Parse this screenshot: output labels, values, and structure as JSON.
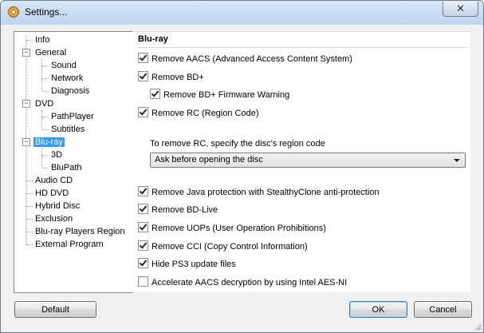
{
  "window": {
    "title": "Settings...",
    "close_glyph": "✕"
  },
  "tree": {
    "items": [
      {
        "label": "Info"
      },
      {
        "label": "General"
      },
      {
        "label": "Sound"
      },
      {
        "label": "Network"
      },
      {
        "label": "Diagnosis"
      },
      {
        "label": "DVD"
      },
      {
        "label": "PathPlayer"
      },
      {
        "label": "Subtitles"
      },
      {
        "label": "Blu-ray"
      },
      {
        "label": "3D"
      },
      {
        "label": "BluPath"
      },
      {
        "label": "Audio CD"
      },
      {
        "label": "HD DVD"
      },
      {
        "label": "Hybrid Disc"
      },
      {
        "label": "Exclusion"
      },
      {
        "label": "Blu-ray Players Region"
      },
      {
        "label": "External Program"
      }
    ],
    "selected": "Blu-ray",
    "expander_glyph": "−"
  },
  "panel": {
    "title": "Blu-ray",
    "options": [
      {
        "label": "Remove AACS (Advanced Access Content System)",
        "checked": true
      },
      {
        "label": "Remove BD+",
        "checked": true
      },
      {
        "label": "Remove BD+ Firmware Warning",
        "checked": true
      },
      {
        "label": "Remove RC (Region Code)",
        "checked": true
      },
      {
        "label": "Remove Java protection with StealthyClone anti-protection",
        "checked": true
      },
      {
        "label": "Remove BD-Live",
        "checked": true
      },
      {
        "label": "Remove UOPs (User Operation Prohibitions)",
        "checked": true
      },
      {
        "label": "Remove CCI (Copy Control Information)",
        "checked": true
      },
      {
        "label": "Hide PS3 update files",
        "checked": true
      },
      {
        "label": "Accelerate AACS decryption by using Intel AES-NI",
        "checked": false
      }
    ],
    "region_hint": "To remove RC, specify the disc's region code",
    "region_select_value": "Ask before opening the disc"
  },
  "buttons": {
    "default_label": "Default",
    "ok_label": "OK",
    "cancel_label": "Cancel"
  },
  "colors": {
    "selection": "#3399ff",
    "titlebar": "#bed4ef"
  }
}
